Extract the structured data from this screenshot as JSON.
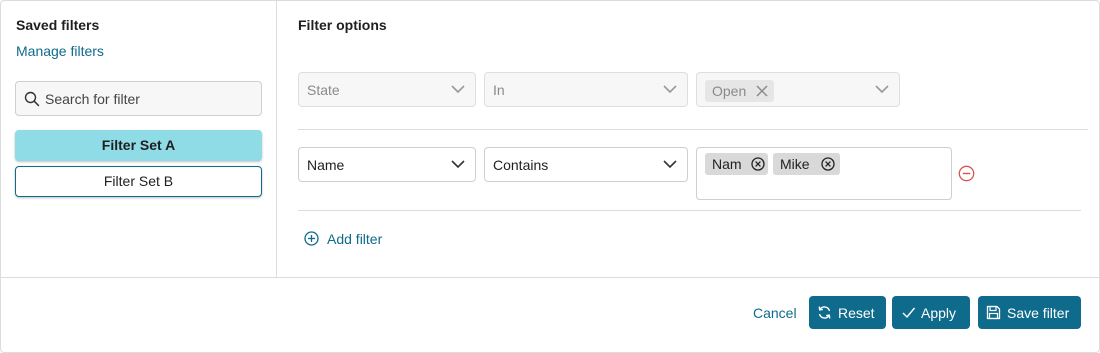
{
  "sidebar": {
    "title": "Saved filters",
    "manage_link": "Manage filters",
    "search_placeholder": "Search for filter",
    "filter_sets": [
      {
        "label": "Filter Set A",
        "selected": true
      },
      {
        "label": "Filter Set B",
        "selected": false
      }
    ]
  },
  "main": {
    "title": "Filter options",
    "rows": [
      {
        "field": "State",
        "operator": "In",
        "values": [
          "Open"
        ],
        "disabled": true
      },
      {
        "field": "Name",
        "operator": "Contains",
        "values": [
          "Nam",
          "Mike"
        ],
        "disabled": false
      }
    ],
    "add_filter_label": "Add filter"
  },
  "footer": {
    "cancel_label": "Cancel",
    "reset_label": "Reset",
    "apply_label": "Apply",
    "save_label": "Save filter"
  },
  "colors": {
    "accent": "#0e6b8c",
    "selected_set": "#8fdbe6",
    "remove": "#d9534f"
  },
  "icons": {
    "search": "search-icon",
    "chevron": "chevron-down-icon",
    "chip_remove": "x-circle-icon",
    "row_remove": "minus-circle-icon",
    "add": "plus-circle-icon",
    "reset": "refresh-icon",
    "apply": "check-icon",
    "save": "floppy-disk-icon"
  }
}
